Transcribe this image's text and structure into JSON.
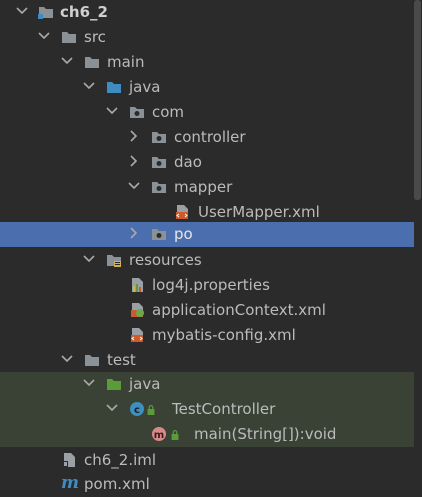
{
  "tree": {
    "root": "ch6_2",
    "src": "src",
    "main": "main",
    "java": "java",
    "com": "com",
    "controller": "controller",
    "dao": "dao",
    "mapper": "mapper",
    "usermapper": "UserMapper.xml",
    "po": "po",
    "resources": "resources",
    "log4j": "log4j.properties",
    "appctx": "applicationContext.xml",
    "mybatis": "mybatis-config.xml",
    "test": "test",
    "test_java": "java",
    "testcontroller": "TestController",
    "main_method": "main(String[]):void",
    "iml": "ch6_2.iml",
    "pom": "pom.xml"
  },
  "colors": {
    "background": "#2b2b2b",
    "selection": "#4b6eaf",
    "test_highlight": "#3a4236",
    "folder": "#8a9297",
    "source_folder": "#3f8dc0",
    "test_folder": "#5a9b3a"
  },
  "icons": {
    "folder": "folder-icon",
    "module": "module-folder-icon",
    "source": "source-folder-icon",
    "package": "package-icon",
    "xml": "xml-file-icon",
    "properties": "properties-file-icon",
    "spring_xml": "spring-xml-icon",
    "class": "class-icon",
    "method": "method-icon",
    "iml": "iml-file-icon",
    "maven": "maven-icon"
  }
}
